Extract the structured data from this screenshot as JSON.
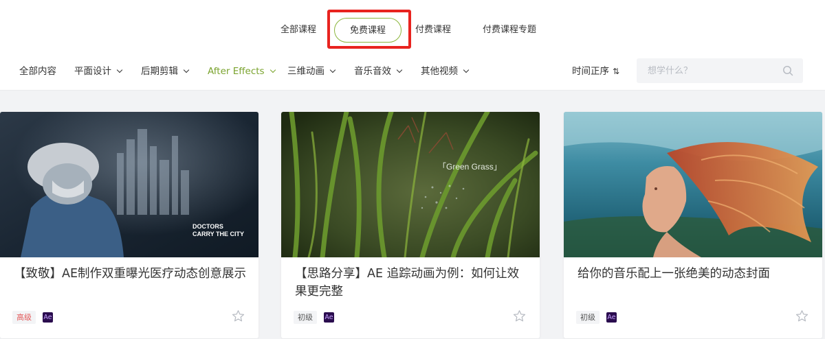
{
  "main_tabs": [
    "全部课程",
    "免费课程",
    "付费课程",
    "付费课程专题"
  ],
  "active_main_tab": "免费课程",
  "filters": [
    "全部内容",
    "平面设计",
    "后期剪辑",
    "After Effects",
    "三维动画",
    "音乐音效",
    "其他视频"
  ],
  "active_filter": "After Effects",
  "sort": {
    "label": "时间正序",
    "icon": "sort-icon"
  },
  "search": {
    "placeholder": "想学什么？",
    "value": ""
  },
  "colors": {
    "accent": "#7aa32e",
    "highlight_box": "#e8231f",
    "level_high": "#e35a5a",
    "ae_badge": "#2a0c4e"
  },
  "cards": [
    {
      "title": "【致敬】AE制作双重曝光医疗动态创意展示",
      "level": "高级",
      "software": "Ae",
      "thumb_text_1": "DOCTORS",
      "thumb_text_2": "CARRY THE CITY"
    },
    {
      "title": "【思路分享】AE 追踪动画为例：如何让效果更完整",
      "level": "初级",
      "software": "Ae",
      "thumb_text_1": "「Green Grass」"
    },
    {
      "title": "给你的音乐配上一张绝美的动态封面",
      "level": "初级",
      "software": "Ae"
    }
  ]
}
